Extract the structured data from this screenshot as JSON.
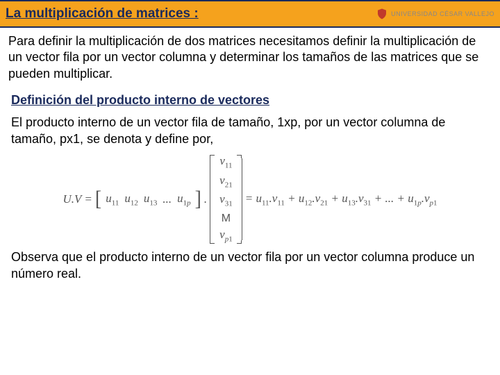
{
  "header": {
    "title": "La multiplicación de matrices :",
    "logo_text": "UNIVERSIDAD CÉSAR VALLEJO"
  },
  "intro": "Para definir la multiplicación de dos matrices necesitamos definir la multiplicación de un vector fila por un vector columna y determinar los tamaños de las matrices que se pueden multiplicar.",
  "subheading": "Definición del producto interno de vectores",
  "def_text": "El producto interno de un vector fila de tamaño, 1xp, por un vector columna de tamaño, px1, se denota y define por,",
  "formula": {
    "lhs": "U.V",
    "row": [
      "u₁₁",
      "u₁₂",
      "u₁₃",
      "...",
      "u₁ₚ"
    ],
    "col": [
      "v₁₁",
      "v₂₁",
      "v₃₁",
      "M",
      "vₚ₁"
    ],
    "rhs": "= u₁₁.v₁₁ + u₁₂.v₂₁ + u₁₃.v₃₁ + ... + u₁ₚ.vₚ₁"
  },
  "closing": "Observa que el producto interno de un vector fila por un vector columna produce un número real."
}
